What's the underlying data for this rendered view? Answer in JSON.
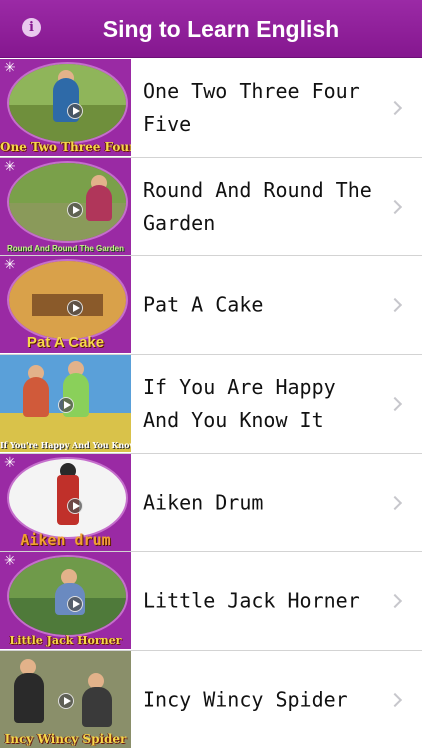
{
  "nav": {
    "title": "Sing to Learn English",
    "info_icon": "info-icon",
    "color": "#8f1f9a"
  },
  "songs": [
    {
      "title": "One Two Three Four Five",
      "thumb_caption": "One Two Three Four Five",
      "thumb_bg": "#8fb55a",
      "thumb_ground": "#6f8f3c"
    },
    {
      "title": "Round And Round The Garden",
      "thumb_caption": "Round And Round The Garden",
      "thumb_bg": "#7aa04a",
      "thumb_ground": "#8a9a5a"
    },
    {
      "title": "Pat A Cake",
      "thumb_caption": "Pat A Cake",
      "thumb_bg": "#d9a14a",
      "thumb_ground": "#b06b3a"
    },
    {
      "title": "If You Are Happy And You Know It",
      "thumb_caption": "If You're Happy And You Know It",
      "thumb_bg": "#5aa0d9",
      "thumb_ground": "#d9c24a"
    },
    {
      "title": "Aiken Drum",
      "thumb_caption": "Aiken drum",
      "thumb_bg": "#f4f4f4",
      "thumb_ground": "#e8e8e8"
    },
    {
      "title": "Little Jack Horner",
      "thumb_caption": "Little Jack Horner",
      "thumb_bg": "#6f9a4a",
      "thumb_ground": "#4f7a3a"
    },
    {
      "title": "Incy Wincy Spider",
      "thumb_caption": "Incy Wincy Spider",
      "thumb_bg": "#8a8f6a",
      "thumb_ground": "#4a4a4a"
    }
  ]
}
